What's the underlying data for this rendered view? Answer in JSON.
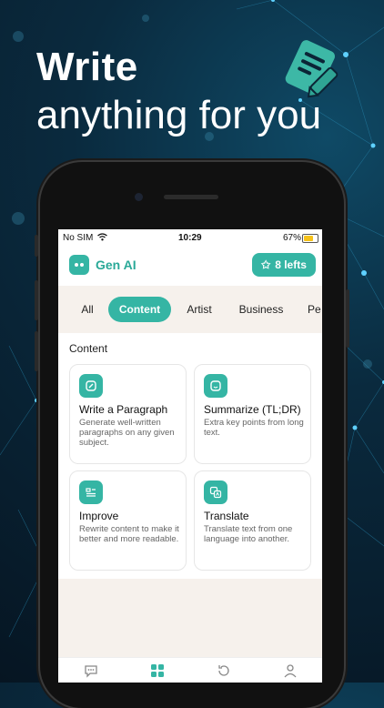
{
  "promo": {
    "headline_bold": "Write",
    "headline_regular": "anything for you",
    "icon": "note-pencil-icon"
  },
  "statusbar": {
    "carrier": "No SIM",
    "time": "10:29",
    "battery": "67%"
  },
  "app": {
    "name": "Gen AI",
    "credits_label": "8 lefts"
  },
  "tabs": [
    {
      "label": "All"
    },
    {
      "label": "Content",
      "active": true
    },
    {
      "label": "Artist"
    },
    {
      "label": "Business"
    },
    {
      "label": "Pe"
    }
  ],
  "section": {
    "title": "Content",
    "cards": [
      {
        "title": "Write a Paragraph",
        "desc": "Generate well-written paragraphs on any given subject.",
        "icon": "paragraph-icon"
      },
      {
        "title": "Summarize (TL;DR)",
        "desc": "Extra key points from long text.",
        "icon": "summarize-icon"
      },
      {
        "title": "Improve",
        "desc": "Rewrite content to make it better and more readable.",
        "icon": "improve-icon"
      },
      {
        "title": "Translate",
        "desc": "Translate text from one language into another.",
        "icon": "translate-icon"
      }
    ]
  },
  "bottom_nav": [
    {
      "icon": "chat-icon"
    },
    {
      "icon": "grid-icon",
      "active": true
    },
    {
      "icon": "history-icon"
    },
    {
      "icon": "profile-icon"
    }
  ],
  "colors": {
    "accent": "#35b5a4",
    "background": "#f6f1ec"
  }
}
